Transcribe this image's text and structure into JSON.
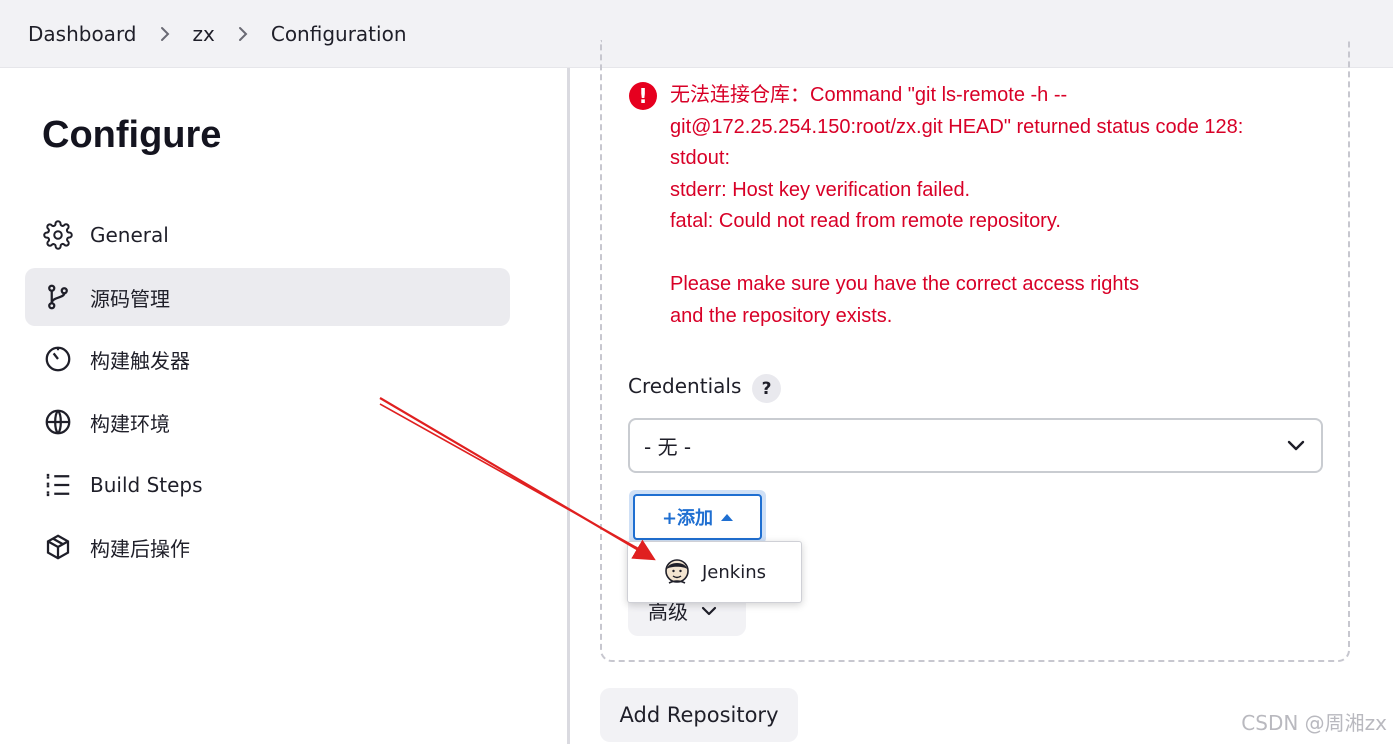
{
  "breadcrumb": {
    "items": [
      "Dashboard",
      "zx",
      "Configuration"
    ]
  },
  "page": {
    "title": "Configure"
  },
  "sidebar": {
    "items": [
      {
        "label": "General",
        "icon": "gear-icon",
        "active": false
      },
      {
        "label": "源码管理",
        "icon": "git-branch-icon",
        "active": true
      },
      {
        "label": "构建触发器",
        "icon": "timer-icon",
        "active": false
      },
      {
        "label": "构建环境",
        "icon": "globe-icon",
        "active": false
      },
      {
        "label": "Build Steps",
        "icon": "list-steps-icon",
        "active": false
      },
      {
        "label": "构建后操作",
        "icon": "package-icon",
        "active": false
      }
    ]
  },
  "scm": {
    "error_message": "无法连接仓库：Command \"git ls-remote -h --\ngit@172.25.254.150:root/zx.git HEAD\" returned status code 128:\nstdout:\nstderr: Host key verification failed.\nfatal: Could not read from remote repository.\n\nPlease make sure you have the correct access rights\nand the repository exists.",
    "credentials_label": "Credentials",
    "help_glyph": "?",
    "credentials_selected": "- 无 -",
    "add_button_label": "+添加",
    "dropdown_items": [
      {
        "label": "Jenkins",
        "icon": "jenkins-icon"
      }
    ],
    "advanced_label": "高级",
    "add_repository_label": "Add Repository"
  },
  "colors": {
    "error": "#d80027",
    "accent": "#1f6fd1",
    "annotation_arrow": "#e02020"
  },
  "watermark": "CSDN @周湘zx"
}
